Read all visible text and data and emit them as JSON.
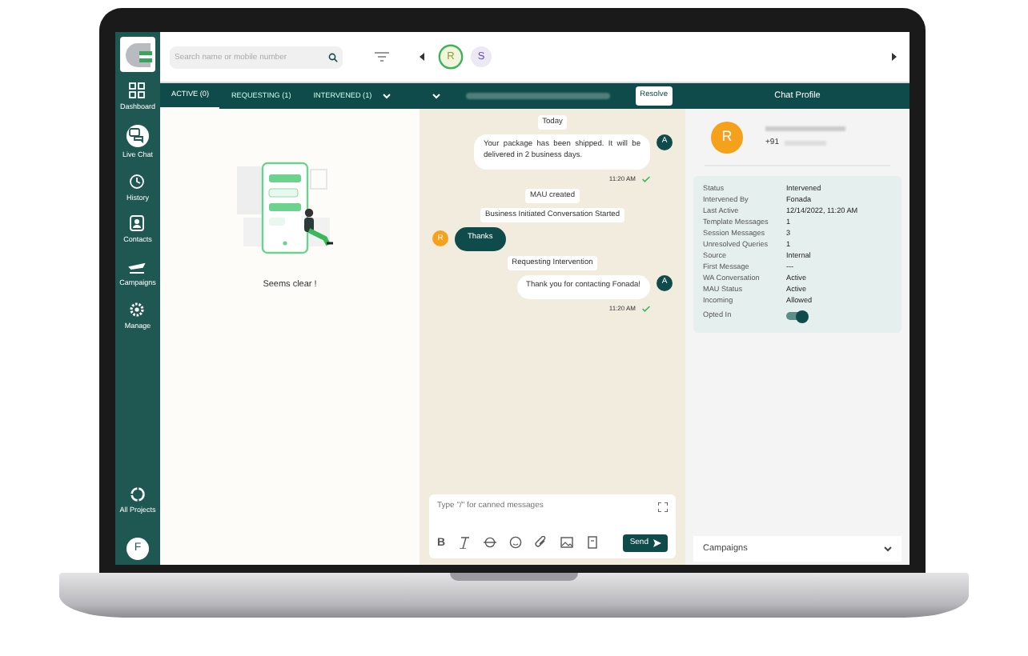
{
  "sidebar": {
    "items": [
      {
        "label": "Dashboard",
        "selected": false
      },
      {
        "label": "Live Chat",
        "selected": true
      },
      {
        "label": "History",
        "selected": false
      },
      {
        "label": "Contacts",
        "selected": false
      },
      {
        "label": "Campaigns",
        "selected": false
      },
      {
        "label": "Manage",
        "selected": false
      }
    ],
    "bottom": {
      "label": "All Projects"
    },
    "user_avatar": "F"
  },
  "search": {
    "placeholder": "Search name or mobile number"
  },
  "contacts": [
    {
      "initial": "R",
      "selected": true
    },
    {
      "initial": "S",
      "selected": false
    }
  ],
  "tabs": [
    {
      "label": "ACTIVE (0)",
      "selected": true
    },
    {
      "label": "REQUESTING (1)",
      "selected": false
    },
    {
      "label": "INTERVENED (1)",
      "selected": false
    }
  ],
  "empty_state": {
    "text": "Seems clear !"
  },
  "chat": {
    "resolve_button": "Resolve",
    "messages": [
      {
        "kind": "date",
        "text": "Today"
      },
      {
        "kind": "out",
        "text": "Your package has been shipped. It will be delivered in 2 business days.",
        "avatar": "A",
        "time": "11:20 AM"
      },
      {
        "kind": "system",
        "text": "MAU created"
      },
      {
        "kind": "system",
        "text": "Business Initiated Conversation Started"
      },
      {
        "kind": "in",
        "text": "Thanks",
        "avatar": "R"
      },
      {
        "kind": "system",
        "text": "Requesting Intervention"
      },
      {
        "kind": "out",
        "text": "Thank you for contacting Fonada!",
        "avatar": "A",
        "time": "11:20 AM"
      }
    ],
    "composer": {
      "placeholder": "Type \"/\" for canned messages",
      "bold_button": "B",
      "send_button": "Send"
    }
  },
  "profile": {
    "title": "Chat Profile",
    "avatar": "R",
    "phone": "+91",
    "fields": [
      {
        "kind": "text",
        "label": "Status",
        "value": "Intervened"
      },
      {
        "kind": "text",
        "label": "Intervened By",
        "value": "Fonada"
      },
      {
        "kind": "text",
        "label": "Last Active",
        "value": "12/14/2022, 11:20 AM"
      },
      {
        "kind": "text",
        "label": "Template Messages",
        "value": "1"
      },
      {
        "kind": "text",
        "label": "Session Messages",
        "value": "3"
      },
      {
        "kind": "text",
        "label": "Unresolved Queries",
        "value": "1"
      },
      {
        "kind": "text",
        "label": "Source",
        "value": "Internal"
      },
      {
        "kind": "text",
        "label": "First Message",
        "value": "---"
      },
      {
        "kind": "text",
        "label": "WA Conversation",
        "value": "Active"
      },
      {
        "kind": "text",
        "label": "MAU Status",
        "value": "Active"
      },
      {
        "kind": "text",
        "label": "Incoming",
        "value": "Allowed"
      },
      {
        "kind": "toggle",
        "label": "Opted In",
        "on": true
      }
    ],
    "campaigns": {
      "label": "Campaigns",
      "expanded": false
    }
  }
}
